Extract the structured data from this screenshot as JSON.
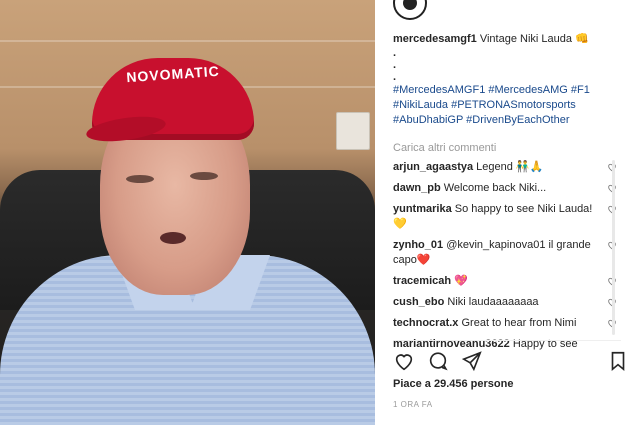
{
  "post": {
    "username": "mercedesamgf1",
    "caption_text": "Vintage Niki Lauda 👊",
    "caption_dots": [
      ".",
      ".",
      "."
    ],
    "hashtags": "#MercedesAMGF1 #MercedesAMG #F1 #NikiLauda #PETRONASmotorsports #AbuDhabiGP #DrivenByEachOther",
    "load_more": "Carica altri commenti",
    "likes": "Piace a 29.456 persone",
    "time": "1 ORA FA",
    "cap_text": "NOVOMATIC"
  },
  "comments": [
    {
      "user": "arjun_agaastya",
      "text": "Legend 👬🙏"
    },
    {
      "user": "dawn_pb",
      "text": "Welcome back Niki..."
    },
    {
      "user": "yuntmarika",
      "text": "So happy to see Niki Lauda!💛"
    },
    {
      "user": "zynho_01",
      "text": "@kevin_kapinova01 il grande capo❤️"
    },
    {
      "user": "tracemicah",
      "text": "💖"
    },
    {
      "user": "cush_ebo",
      "text": "Niki laudaaaaaaaa"
    },
    {
      "user": "technocrat.x",
      "text": "Great to hear from Nimi"
    },
    {
      "user": "mariantirnoveanu3622",
      "text": "Happy to see"
    }
  ],
  "icons": [
    "heart-icon",
    "comment-icon",
    "share-icon",
    "bookmark-icon"
  ],
  "colors": {
    "hashtag": "#1a4a8c",
    "cap": "#c8102e",
    "muted": "#999999"
  }
}
